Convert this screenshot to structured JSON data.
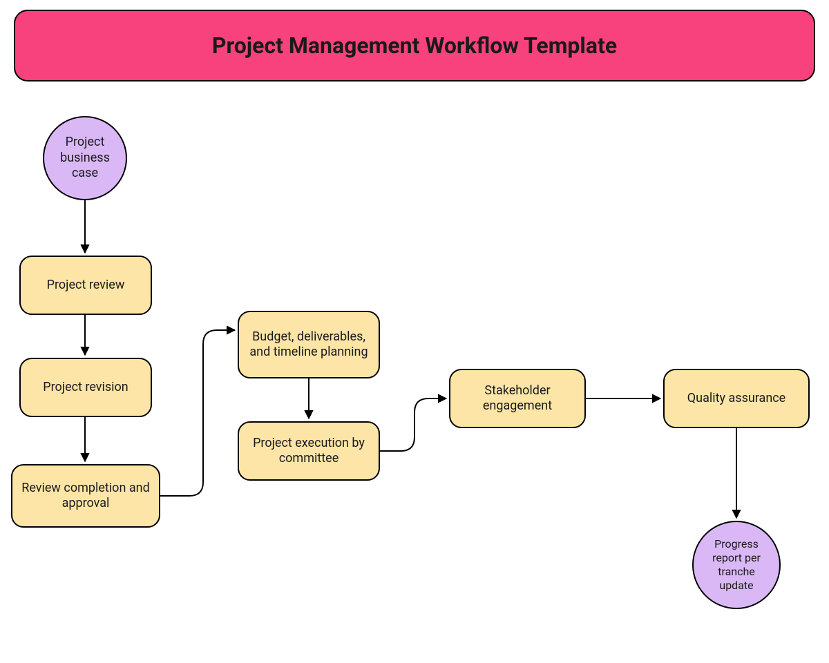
{
  "title": "Project Management Workflow Template",
  "nodes": {
    "start": {
      "label": "Project business case"
    },
    "review": {
      "label": "Project review"
    },
    "revision": {
      "label": "Project revision"
    },
    "completion": {
      "label": "Review completion and approval"
    },
    "planning": {
      "label": "Budget, deliverables, and timeline planning"
    },
    "execution": {
      "label": "Project execution by committee"
    },
    "stakeholder": {
      "label": "Stakeholder engagement"
    },
    "qa": {
      "label": "Quality assurance"
    },
    "report": {
      "label": "Progress report per tranche update"
    }
  },
  "colors": {
    "banner": "#f7427e",
    "circle": "#d9b8f5",
    "rect": "#fce5a6",
    "stroke": "#000000"
  }
}
